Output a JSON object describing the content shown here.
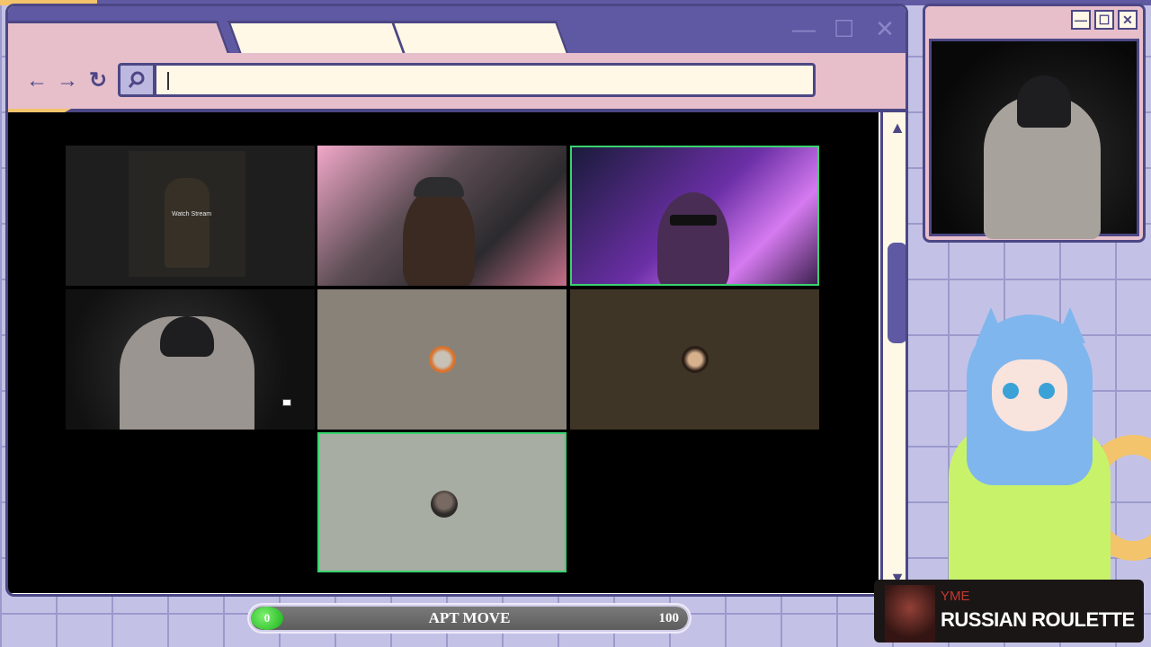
{
  "browser": {
    "window_controls": [
      "—",
      "☐",
      "✕"
    ],
    "nav": {
      "back": "←",
      "forward": "→",
      "reload": "↻"
    },
    "url_value": ""
  },
  "call": {
    "tiles": [
      {
        "name": "screen-share-tile",
        "overlay": "Watch Stream"
      },
      {
        "name": "webcam-tile-bearded"
      },
      {
        "name": "webcam-tile-sunglasses"
      },
      {
        "name": "webcam-tile-hoodie"
      },
      {
        "name": "avatar-tile-1"
      },
      {
        "name": "avatar-tile-2"
      },
      {
        "name": "avatar-tile-3"
      }
    ]
  },
  "cam_window": {
    "buttons": [
      "—",
      "☐",
      "✕"
    ]
  },
  "progress": {
    "value_label": "0",
    "title": "APT MOVE",
    "max_label": "100",
    "fraction": 0.0
  },
  "redeem": {
    "user": "YME",
    "title": "RUSSIAN ROULETTE"
  },
  "colors": {
    "accent": "#5e59a2",
    "pink": "#e7bfcb",
    "cream": "#fff8e6",
    "yellow": "#f3c46b",
    "speaking_border": "#39d36f"
  }
}
